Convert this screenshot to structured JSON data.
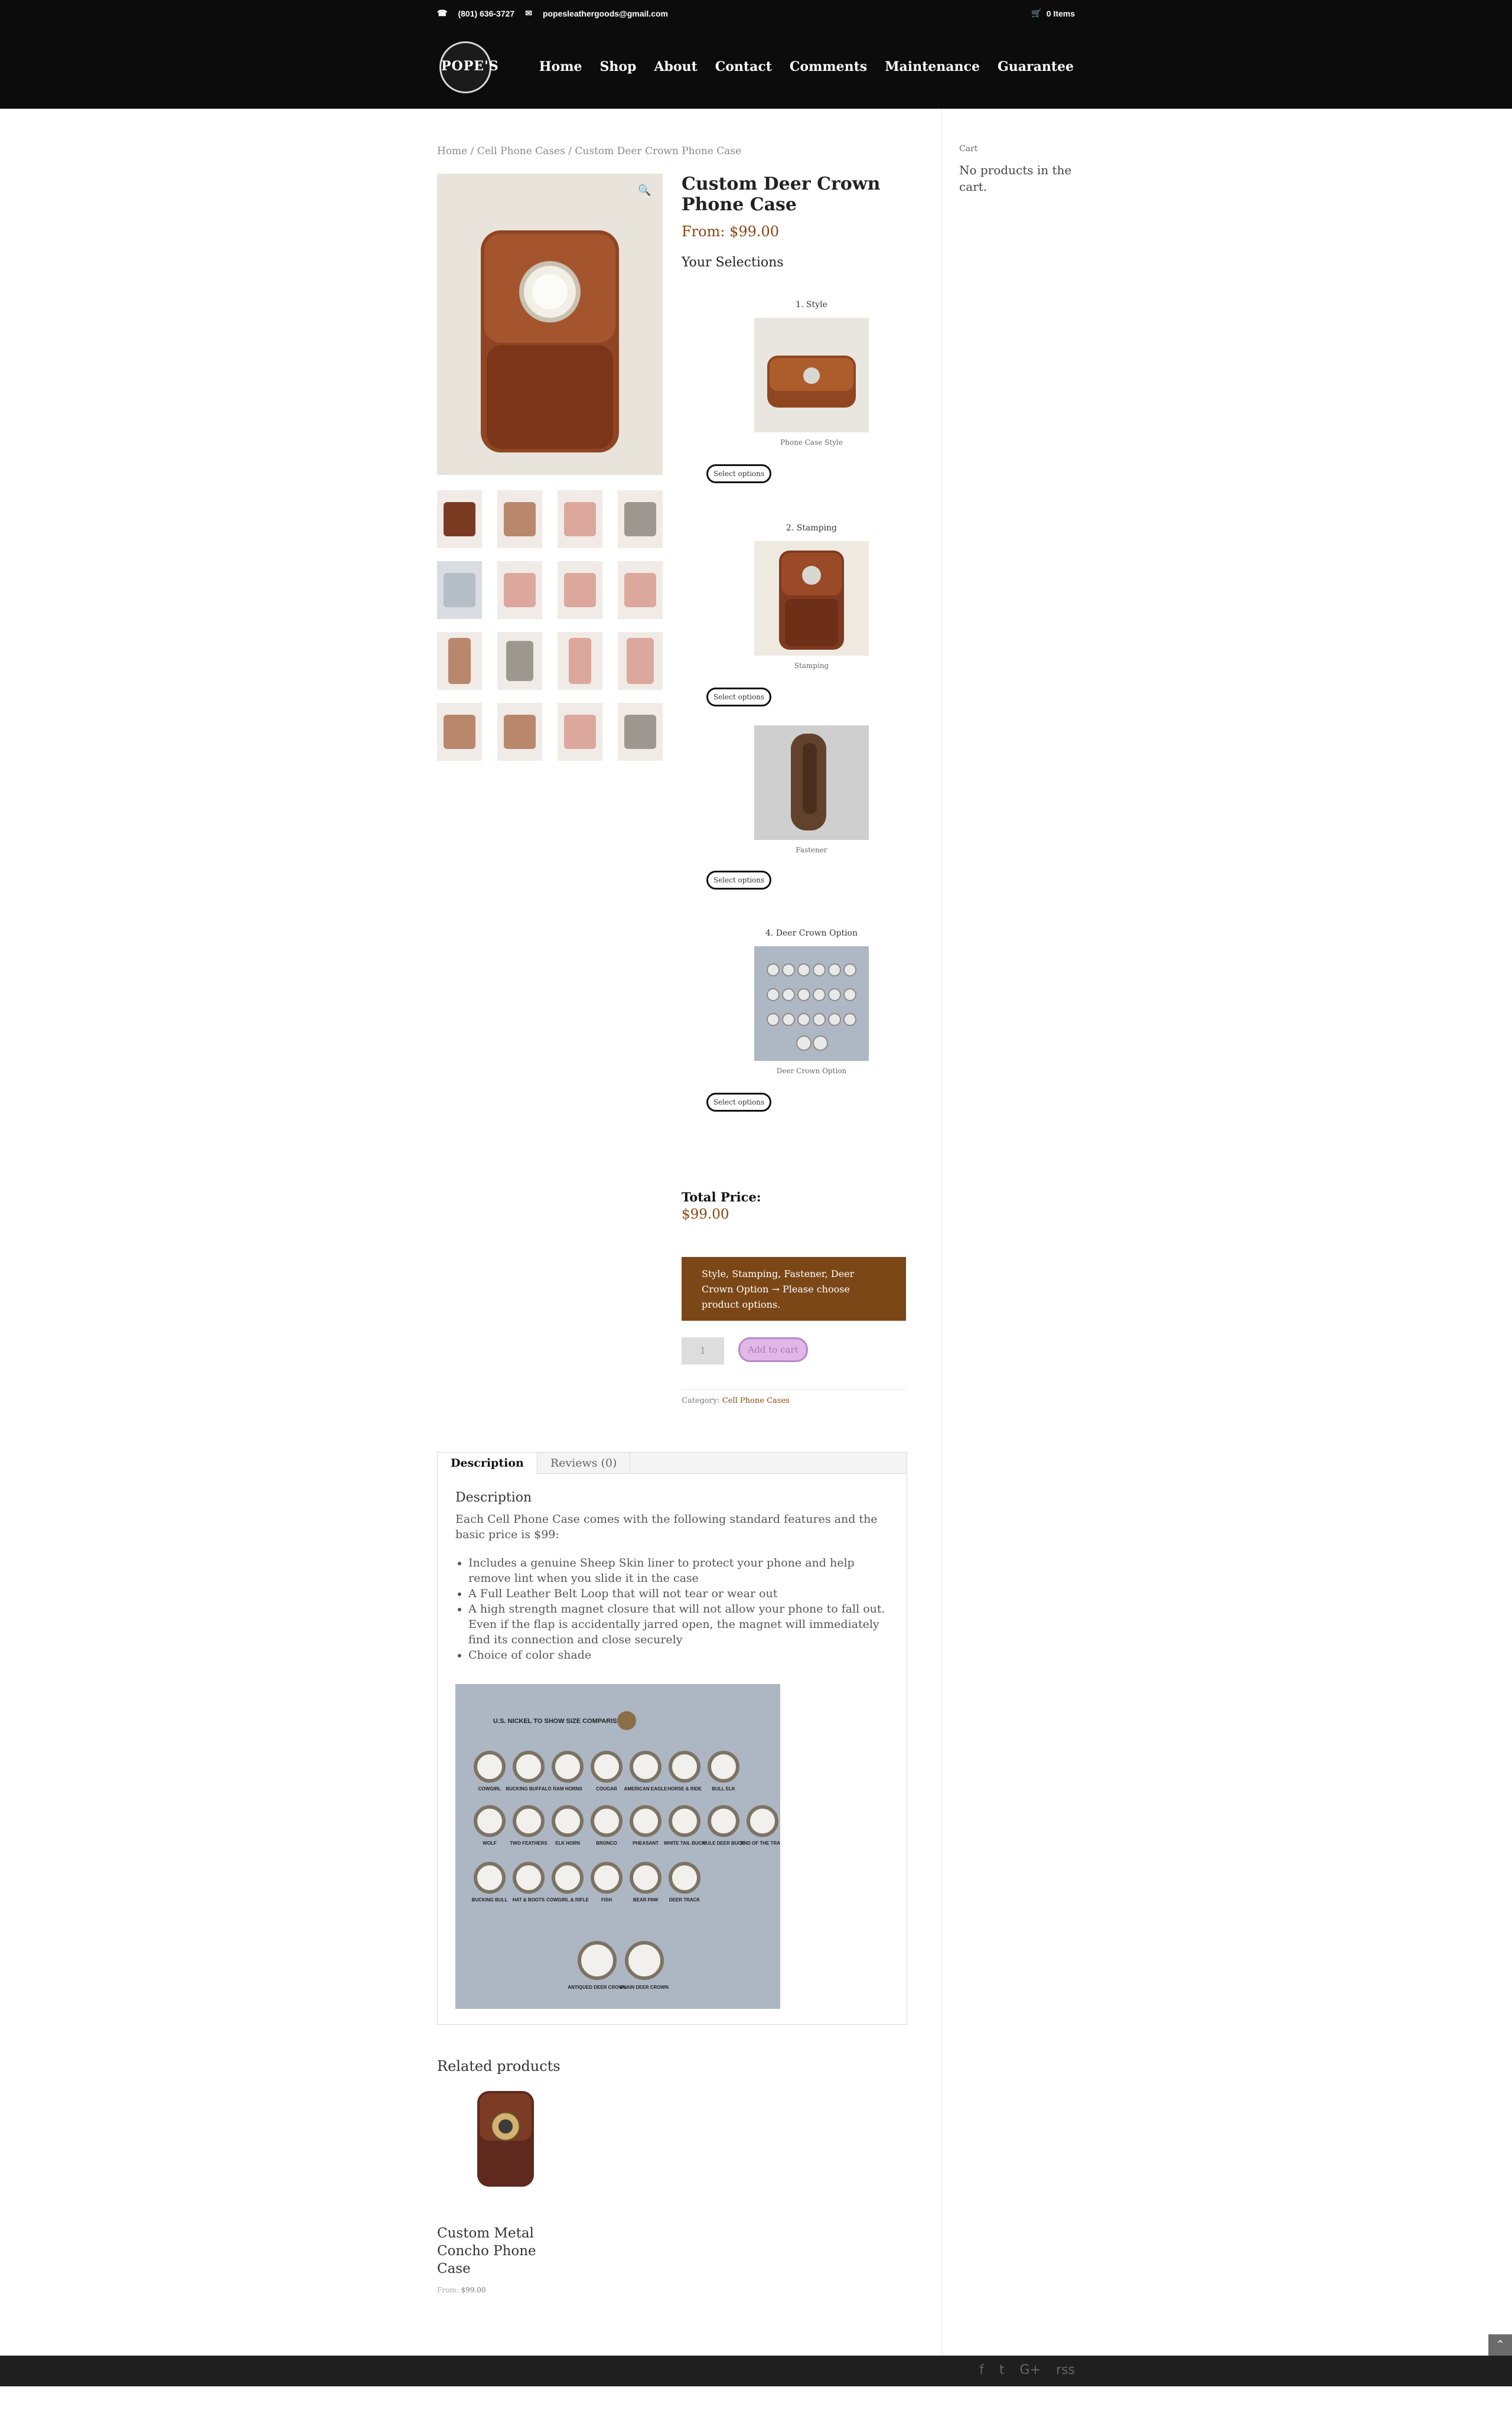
{
  "topbar": {
    "phone": "(801) 636-3727",
    "email": "popesleathergoods@gmail.com",
    "cart_items": "0 Items"
  },
  "logo": {
    "text": "POPE'S"
  },
  "nav": [
    "Home",
    "Shop",
    "About",
    "Contact",
    "Comments",
    "Maintenance",
    "Guarantee"
  ],
  "breadcrumb": {
    "home": "Home",
    "separator": " / ",
    "category": "Cell Phone Cases",
    "current": "Custom Deer Crown Phone Case"
  },
  "product": {
    "title": "Custom Deer Crown Phone Case",
    "price": "From: $99.00"
  },
  "selections": {
    "title": "Your Selections",
    "steps": [
      {
        "title": "1. Style",
        "caption": "Phone Case Style",
        "button": "Select options"
      },
      {
        "title": "2. Stamping",
        "caption": "Stamping",
        "button": "Select options"
      },
      {
        "title": "",
        "caption": "Fastener",
        "button": "Select options"
      },
      {
        "title": "4. Deer Crown Option",
        "caption": "Deer Crown Option",
        "button": "Select options"
      }
    ]
  },
  "total": {
    "label": "Total Price:",
    "value": "$99.00"
  },
  "notice": "Style, Stamping, Fastener, Deer Crown Option → Please choose product options.",
  "cart_form": {
    "qty": "1",
    "button": "Add to cart"
  },
  "category": {
    "label": "Category:",
    "value": "Cell Phone Cases"
  },
  "tabs": [
    "Description",
    "Reviews (0)"
  ],
  "description": {
    "heading": "Description",
    "intro": "Each Cell Phone Case comes with the following standard features and the basic price is $99:",
    "features": [
      "Includes a genuine Sheep Skin liner to protect your phone and help remove lint when you slide it in the case",
      "A Full Leather Belt Loop that will not tear or wear out",
      "A high strength magnet closure that will not allow your phone to fall out. Even if the flap is accidentally jarred open, the magnet will immediately find its connection and close securely",
      "Choice of color shade"
    ],
    "image_title": "U.S. NICKEL TO SHOW SIZE COMPARISON",
    "image_labels": [
      "COWGIRL",
      "BUCKING BUFFALO",
      "RAM HORNS",
      "COUGAR",
      "AMERICAN EAGLE",
      "HORSE & RIDE",
      "BULL ELK",
      "WOLF",
      "TWO FEATHERS",
      "ELK HORN",
      "BRONCO",
      "PHEASANT",
      "WHITE TAIL BUCK",
      "MULE DEER BUCK",
      "END OF THE TRAIL",
      "BUCKING BULL",
      "HAT & BOOTS",
      "COWGIRL & RIFLE",
      "FISH",
      "BEAR PAW",
      "DEER TRACK",
      "ANTIQUED DEER CROWN",
      "PLAIN DEER CROWN"
    ]
  },
  "related": {
    "title": "Related products",
    "name": "Custom Metal Concho Phone Case",
    "price_from": "From:",
    "price": "$99.00"
  },
  "sidebar": {
    "title": "Cart",
    "text": "No products in the cart."
  },
  "footer": {
    "social": [
      "f",
      "t",
      "G+",
      "rss"
    ]
  }
}
